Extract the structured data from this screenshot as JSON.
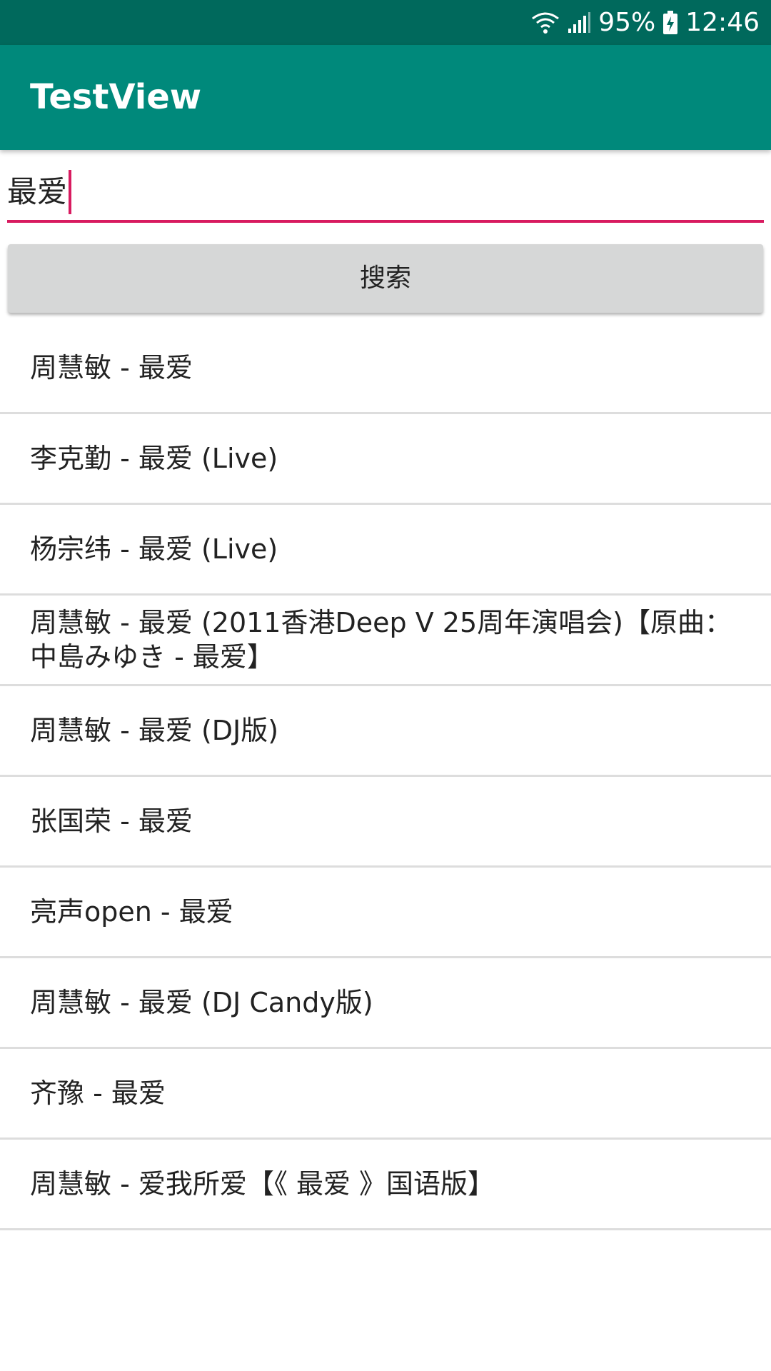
{
  "status_bar": {
    "battery": "95%",
    "time": "12:46",
    "icons": [
      "wifi-icon",
      "signal-icon",
      "battery-charging-icon"
    ]
  },
  "app_bar": {
    "title": "TestView",
    "color": "#00897b"
  },
  "search": {
    "value": "最爱",
    "underline_color": "#d81b60"
  },
  "search_button": {
    "label": "搜索"
  },
  "results": [
    {
      "title": "周慧敏 - 最爱"
    },
    {
      "title": "李克勤 - 最爱 (Live)"
    },
    {
      "title": "杨宗纬 - 最爱 (Live)"
    },
    {
      "title": "周慧敏 - 最爱 (2011香港Deep V 25周年演唱会)【原曲：中島みゆき - 最爱】"
    },
    {
      "title": "周慧敏 - 最爱 (DJ版)"
    },
    {
      "title": "张国荣 - 最爱"
    },
    {
      "title": "亮声open - 最爱"
    },
    {
      "title": "周慧敏 - 最爱 (DJ Candy版)"
    },
    {
      "title": "齐豫 - 最爱"
    },
    {
      "title": "周慧敏 - 爱我所爱【《 最爱 》国语版】"
    }
  ]
}
